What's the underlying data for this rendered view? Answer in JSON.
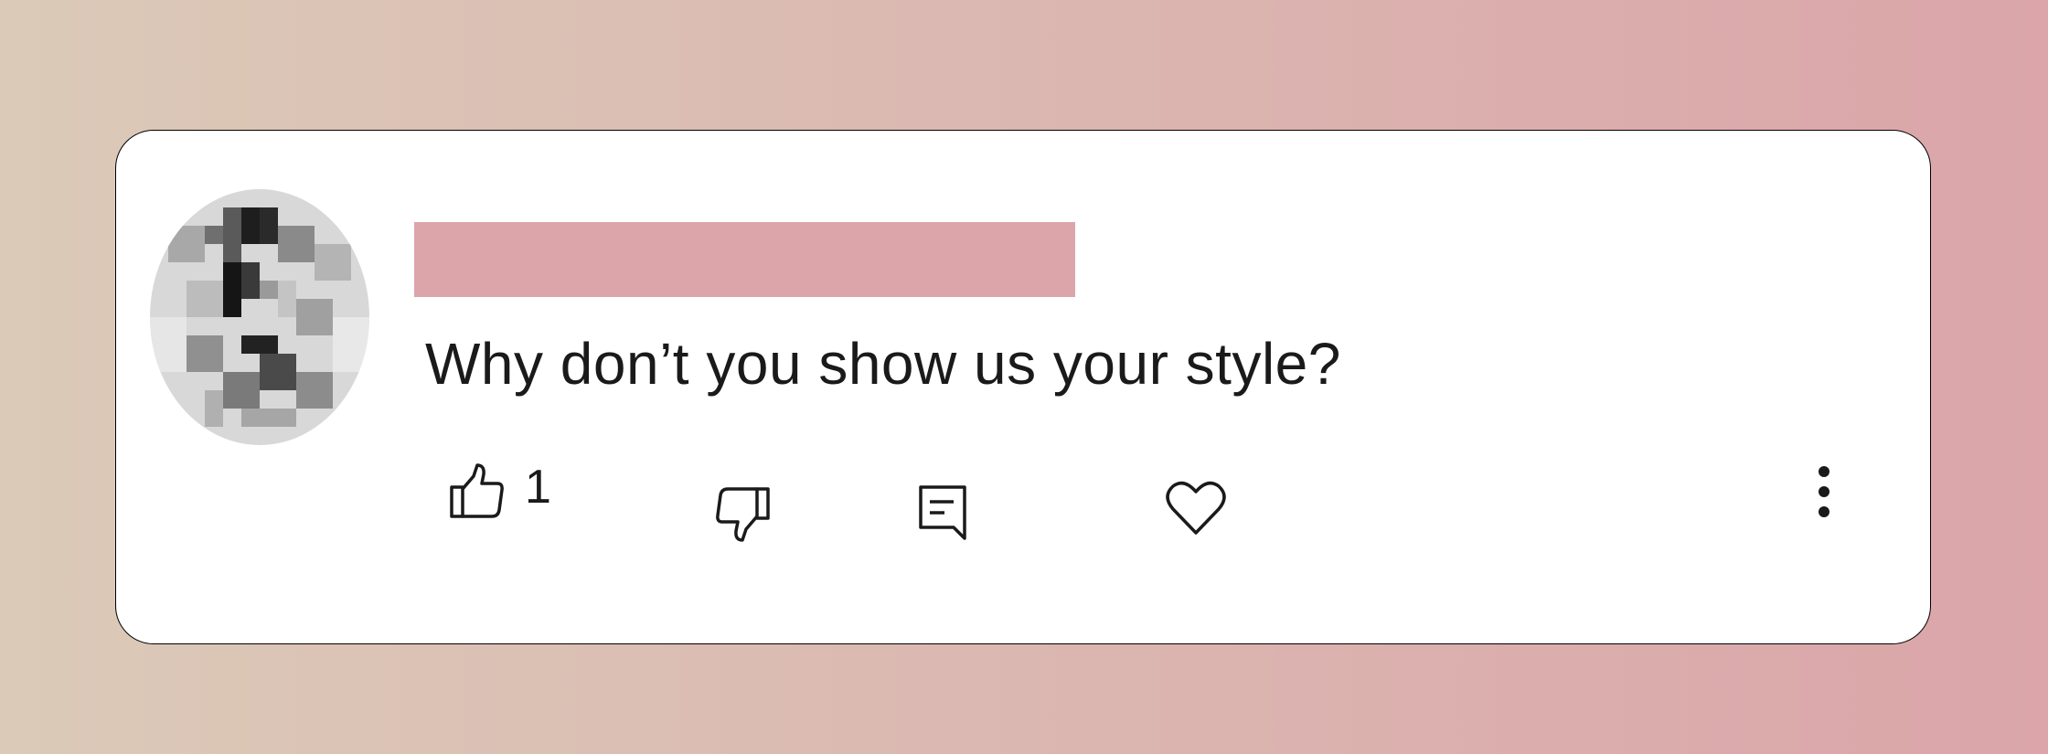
{
  "comment": {
    "author_redacted": true,
    "text": "Why don’t you show us your style?",
    "like_count": "1"
  },
  "actions": {
    "like_icon": "thumbs-up-icon",
    "dislike_icon": "thumbs-down-icon",
    "reply_icon": "reply-comment-icon",
    "heart_icon": "heart-icon",
    "more_icon": "more-vertical-icon"
  },
  "colors": {
    "background_start": "#dbcab8",
    "background_end": "#dba5a9",
    "redaction_bar": "#dba5a9",
    "card": "#ffffff",
    "text": "#1a1a1a"
  }
}
